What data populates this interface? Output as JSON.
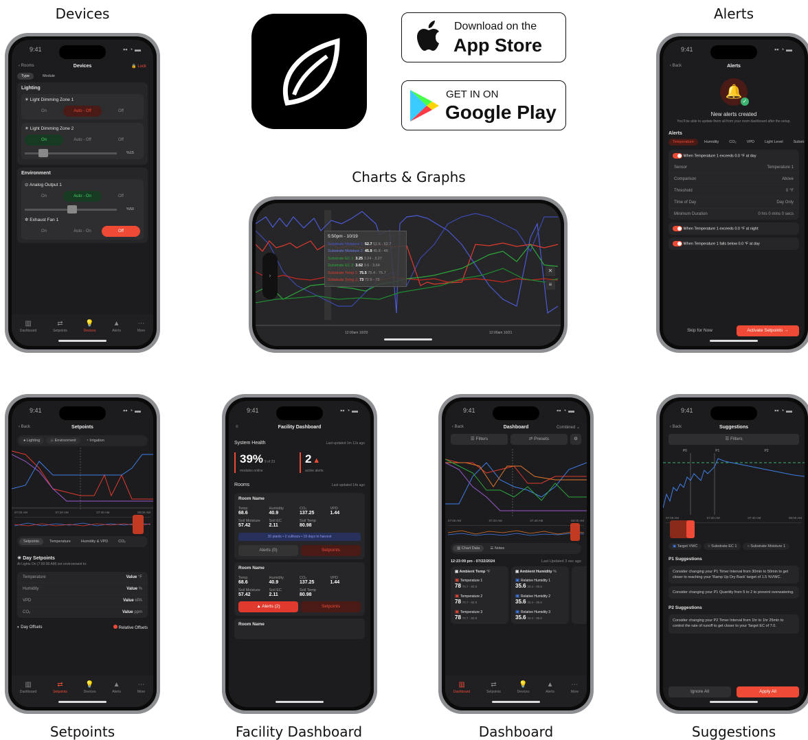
{
  "captions": {
    "devices": "Devices",
    "alerts": "Alerts",
    "charts": "Charts & Graphs",
    "setpoints": "Setpoints",
    "facility": "Facility Dashboard",
    "dashboard": "Dashboard",
    "suggestions": "Suggestions"
  },
  "time": "9:41",
  "stores": {
    "apple_small": "Download on the",
    "apple_big": "App Store",
    "google_small": "GET IN ON",
    "google_big": "Google Play"
  },
  "tabs": [
    "Dashboard",
    "Setpoints",
    "Devices",
    "Alerts",
    "More"
  ],
  "devices": {
    "back": "Rooms",
    "title": "Devices",
    "lock": "Lock",
    "type": "Type",
    "module": "Module",
    "lighting": "Lighting",
    "zone1": "Light Dimming Zone 1",
    "zone2": "Light Dimming Zone 2",
    "on": "On",
    "auto_off": "Auto - Off",
    "off": "Off",
    "auto_on": "Auto - On",
    "pct15": "%15",
    "env": "Environment",
    "analog": "Analog Output 1",
    "pct50": "%50",
    "fan": "Exhaust Fan 1"
  },
  "alerts": {
    "back": "Back",
    "title": "Alerts",
    "created": "New alerts created",
    "sub": "You'll be able to update them all from your room dashboard after the setup.",
    "section": "Alerts",
    "tabs": [
      "Temperature",
      "Humidity",
      "CO₂",
      "VPD",
      "Light Level",
      "Substrate pH"
    ],
    "rule1": "When Temperature 1 exceeds 0.0 °F at day",
    "rows": [
      [
        "Sensor",
        "Temperature 1"
      ],
      [
        "Comparison",
        "Above"
      ],
      [
        "Threshold",
        "0 °F"
      ],
      [
        "Time of Day",
        "Day Only"
      ],
      [
        "Minimum Duration",
        "0 hrs 0 mins 0 secs"
      ]
    ],
    "rule2": "When Temperature 1 exceeds 0.0 °F at night",
    "rule3": "When Temperature 1 falls below 0.0 °F at day",
    "skip": "Skip for Now",
    "activate": "Activate Setpoints"
  },
  "chart": {
    "tip_title": "5:50pm - 10/19",
    "tips": [
      [
        "Substrate Moisture 1:",
        "52.7",
        "52.6 - 52.7"
      ],
      [
        "Substrate Moisture 2:",
        "45.9",
        "45.8 - 46"
      ],
      [
        "Substrate EC 1:",
        "3.25",
        "3.24 - 3.27"
      ],
      [
        "Substrate EC 2:",
        "3.62",
        "3.6 - 3.64"
      ],
      [
        "Substrate Temp 1:",
        "75.5",
        "75.4 - 75.7"
      ],
      [
        "Substrate Temp 2:",
        "73",
        "72.9 - 73"
      ]
    ],
    "x1": "12:00am 10/20",
    "x2": "12:00am 10/21"
  },
  "setpoints": {
    "back": "Back",
    "title": "Setpoints",
    "filters": [
      "Lighting",
      "Environment",
      "Irrigation"
    ],
    "x": [
      "07:00 AM",
      "07:20 AM",
      "07:40 AM",
      "08:00 AM"
    ],
    "tabs": [
      "Setpoints",
      "Temperature",
      "Humidity & VPD",
      "CO₂"
    ],
    "day": "Day Setpoints",
    "day_sub": "At Lights On (7:00:00 AM) set environment to:",
    "rows": [
      [
        "Temperature",
        "Value",
        "°F"
      ],
      [
        "Humidity",
        "Value",
        "%"
      ],
      [
        "VPD",
        "Value",
        "kPA"
      ],
      [
        "CO₂",
        "Value",
        "ppm"
      ]
    ],
    "offsets": "Day Offsets",
    "rel": "Relative Offsets"
  },
  "facility": {
    "title": "Facility Dashboard",
    "health": "System Health",
    "updated": "Last updated 1m 12s ago",
    "pct": "39%",
    "of": "9 of 23",
    "online": "modules online",
    "alerts_n": "2",
    "active": "active alerts",
    "rooms": "Rooms",
    "rooms_upd": "Last updated 14s ago",
    "room": "Room Name",
    "labels": [
      "Temp",
      "Humidity",
      "CO₂",
      "VPD"
    ],
    "vals": [
      "68.6",
      "40.9",
      "137.25",
      "1.44"
    ],
    "labels2": [
      "Soil Moisture",
      "Soil EC",
      "Soil Temp"
    ],
    "vals2": [
      "57.42",
      "2.11",
      "80.98"
    ],
    "summary": "20 plants • 2 cultivars • 19 days to harvest",
    "alerts0": "Alerts (0)",
    "alerts2": "Alerts (2)",
    "setpoints": "Setpoints"
  },
  "dash": {
    "back": "Back",
    "title": "Dashboard",
    "combined": "Combined",
    "filters": "Filters",
    "presets": "Presets",
    "x": [
      "07:00 AM",
      "07:20 AM",
      "07:40 AM",
      "08:00 AM"
    ],
    "chartdata": "Chart Data",
    "notes": "Notes",
    "time": "12:23:09 pm - 07/22/2024",
    "upd": "Last Updated 3 sec ago",
    "col1": "Ambient Temp",
    "col2": "Ambient Humidity",
    "t": [
      "Temperature 1",
      "Temperature 2",
      "Temperature 3"
    ],
    "tv": "78",
    "tr": "70.7 - 82.9",
    "h": [
      "Relative Humidity 1",
      "Relative Humidity 2",
      "Relative Humidity 3"
    ],
    "hv": "35.6",
    "hr": "33.4 - 35.6"
  },
  "sugg": {
    "back": "Back",
    "title": "Suggestions",
    "filters": "Filters",
    "p": [
      "P0",
      "P1",
      "P2"
    ],
    "chips": [
      "Target VWC",
      "Substrate EC 1",
      "Substrate Moisture 1"
    ],
    "p1": "P1 Suggestions",
    "s1": "Consider changing your P1 Timer Interval from 30min to 50min to get closer to reaching your 'Ramp Up Dry Back' target of 1.5 %VWC.",
    "s2": "Consider changing your P1 Quantity from 5 to 2 to prevent overwatering.",
    "p2": "P2 Suggestions",
    "s3": "Consider changing your P2 Timer Interval from 1hr to 1hr 25min to control the rate of runoff to get closer to your Target EC of 7.0.",
    "ignore": "Ignore All",
    "apply": "Apply All"
  }
}
